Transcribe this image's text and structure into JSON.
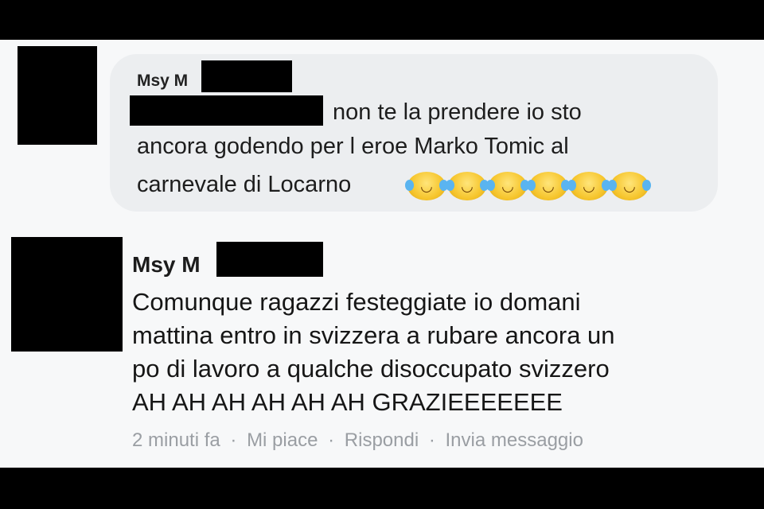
{
  "quoted_comment": {
    "author_visible": "Msy M",
    "line1": "non te la prendere io sto",
    "line2": "ancora godendo per l eroe Marko Tomic al",
    "line3": "carnevale di Locarno",
    "emoji_count": 6,
    "emoji_icon": "face-with-tears-of-joy-icon"
  },
  "comment": {
    "author_visible": "Msy M",
    "lines": [
      "Comunque ragazzi festeggiate io domani",
      "mattina entro in svizzera a rubare ancora un",
      "po di lavoro a qualche disoccupato svizzero",
      "AH AH AH AH AH AH GRAZIEEEEEEE"
    ],
    "timestamp": "2 minuti fa",
    "like": "Mi piace",
    "reply": "Rispondi",
    "send_message": "Invia messaggio",
    "separator": "·"
  }
}
